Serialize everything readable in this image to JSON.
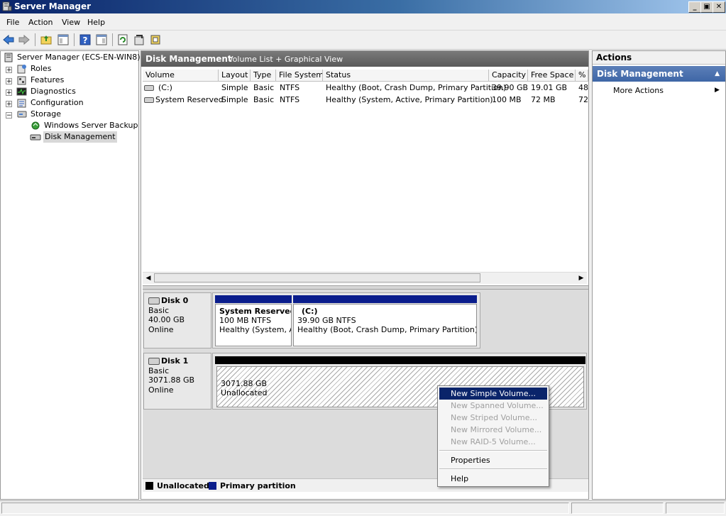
{
  "window": {
    "title": "Server Manager",
    "icon": "server-manager-icon",
    "buttons": {
      "minimize": "_",
      "restore": "▣",
      "close": "✕"
    }
  },
  "menubar": {
    "items": [
      "File",
      "Action",
      "View",
      "Help"
    ]
  },
  "toolbar": {
    "icons": [
      "back-arrow-icon",
      "forward-arrow-icon",
      "up-folder-icon",
      "show-hide-tree-icon",
      "help-icon",
      "show-hide-action-pane-icon",
      "refresh-icon",
      "properties-icon",
      "export-icon"
    ]
  },
  "tree": {
    "root": "Server Manager (ECS-EN-WIN8)",
    "items": [
      "Roles",
      "Features",
      "Diagnostics",
      "Configuration",
      "Storage"
    ],
    "storage_children": [
      "Windows Server Backup",
      "Disk Management"
    ],
    "expanders": {
      "plus": "+",
      "minus": "−"
    }
  },
  "center": {
    "title": "Disk Management",
    "subtitle": "Volume List + Graphical View",
    "columns": [
      "Volume",
      "Layout",
      "Type",
      "File System",
      "Status",
      "Capacity",
      "Free Space",
      "%"
    ],
    "rows": [
      {
        "volume": "(C:)",
        "layout": "Simple",
        "type": "Basic",
        "fs": "NTFS",
        "status": "Healthy (Boot, Crash Dump, Primary Partition)",
        "capacity": "39.90 GB",
        "free": "19.01 GB",
        "pct": "48"
      },
      {
        "volume": "System Reserved",
        "layout": "Simple",
        "type": "Basic",
        "fs": "NTFS",
        "status": "Healthy (System, Active, Primary Partition)",
        "capacity": "100 MB",
        "free": "72 MB",
        "pct": "72"
      }
    ],
    "scroll": {
      "left": "◀",
      "right": "▶"
    }
  },
  "disks": [
    {
      "name": "Disk 0",
      "type": "Basic",
      "size": "40.00 GB",
      "state": "Online",
      "partitions": [
        {
          "title": "System Reserved",
          "line2": "100 MB NTFS",
          "line3": "Healthy (System, Active, Primary Partition)"
        },
        {
          "title": "(C:)",
          "line2": "39.90 GB NTFS",
          "line3": "Healthy (Boot, Crash Dump, Primary Partition)"
        }
      ]
    },
    {
      "name": "Disk 1",
      "type": "Basic",
      "size": "3071.88 GB",
      "state": "Online",
      "partitions": [
        {
          "line1": "3071.88 GB",
          "line2": "Unallocated"
        }
      ]
    }
  ],
  "legend": {
    "unallocated": "Unallocated",
    "primary": "Primary partition"
  },
  "actions": {
    "header": "Actions",
    "section": "Disk Management",
    "section_arrow": "▲",
    "item": "More Actions",
    "item_arrow": "▶"
  },
  "context_menu": {
    "items": [
      "New Simple Volume...",
      "New Spanned Volume...",
      "New Striped Volume...",
      "New Mirrored Volume...",
      "New RAID-5 Volume..."
    ],
    "properties": "Properties",
    "help": "Help"
  },
  "colors": {
    "primary": "#0a1d8c",
    "unallocated": "#000000",
    "selection": "#0a246a",
    "actions_header": "#3e66a6"
  }
}
